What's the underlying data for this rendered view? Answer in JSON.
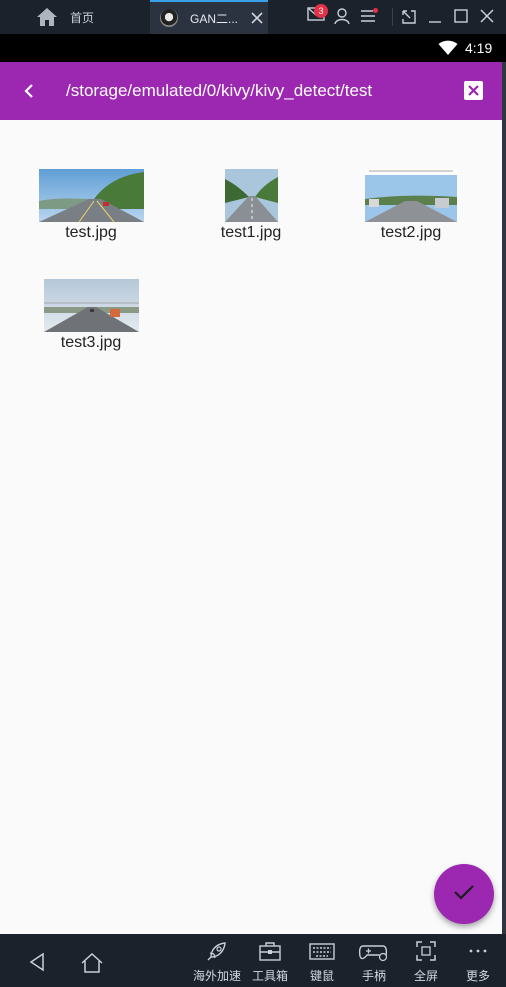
{
  "titlebar": {
    "home_tab_label": "首页",
    "app_tab_label": "GAN二...",
    "mail_badge": "3"
  },
  "statusbar": {
    "time": "4:19"
  },
  "appbar": {
    "path": "/storage/emulated/0/kivy/kivy_detect/test"
  },
  "files": [
    {
      "name": "test.jpg"
    },
    {
      "name": "test1.jpg"
    },
    {
      "name": "test2.jpg"
    },
    {
      "name": "test3.jpg"
    }
  ],
  "bottombar": {
    "items": [
      {
        "label": "海外加速",
        "icon": "rocket-icon"
      },
      {
        "label": "工具箱",
        "icon": "toolbox-icon"
      },
      {
        "label": "键鼠",
        "icon": "keyboard-icon"
      },
      {
        "label": "手柄",
        "icon": "gamepad-icon"
      },
      {
        "label": "全屏",
        "icon": "fullscreen-icon"
      },
      {
        "label": "更多",
        "icon": "more-icon"
      }
    ]
  },
  "colors": {
    "accent": "#9c27b0",
    "window_chrome": "#1c222c"
  }
}
